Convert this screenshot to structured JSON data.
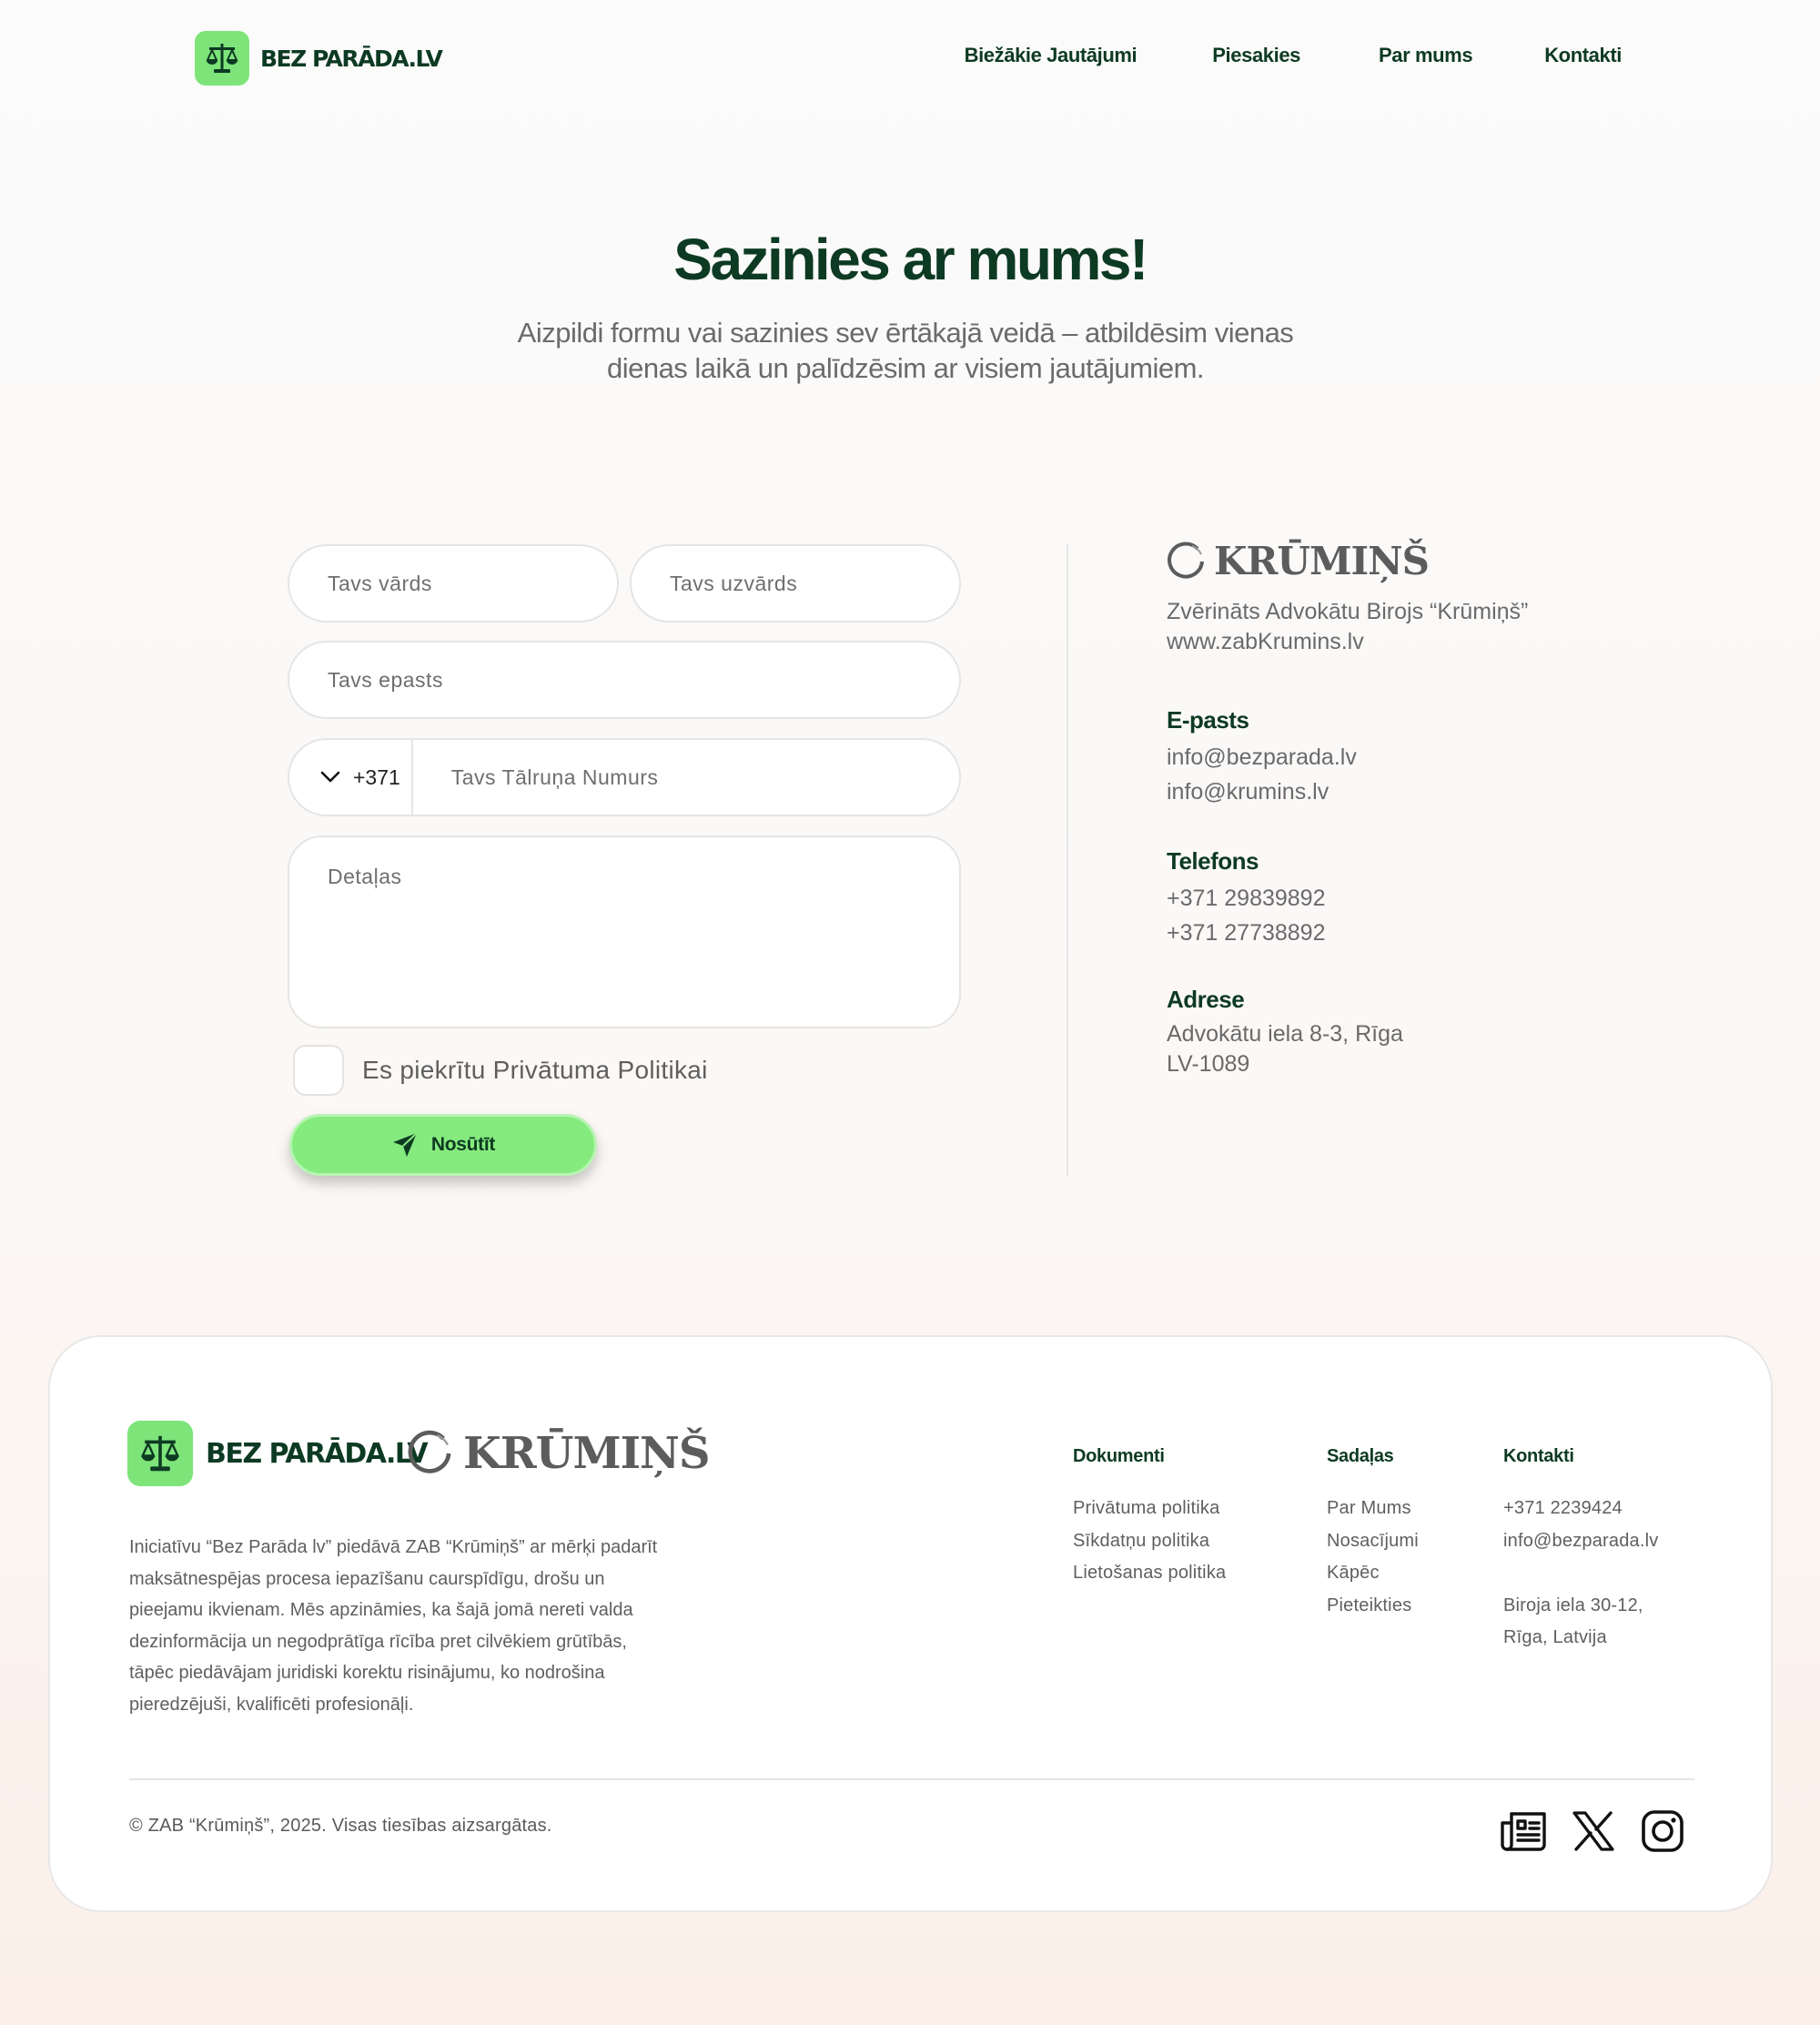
{
  "header": {
    "logo_text": "BEZ PARĀDA.LV",
    "nav": [
      "Biežākie Jautājumi",
      "Piesakies",
      "Par mums",
      "Kontakti"
    ]
  },
  "hero": {
    "title": "Sazinies ar mums!",
    "subtitle_line1": "Aizpildi formu vai sazinies sev ērtākajā veidā – atbildēsim vienas",
    "subtitle_line2": "dienas laikā un palīdzēsim ar visiem jautājumiem."
  },
  "form": {
    "name_placeholder": "Tavs vārds",
    "surname_placeholder": "Tavs uzvārds",
    "email_placeholder": "Tavs epasts",
    "country_code": "+371",
    "phone_placeholder": "Tavs Tālruņa Numurs",
    "details_placeholder": "Detaļas",
    "consent_label": "Es piekrītu Privātuma Politikai",
    "submit_label": "Nosūtīt"
  },
  "contact": {
    "brand": "KRŪMIŅŠ",
    "firm_name": "Zvērināts Advokātu Birojs “Krūmiņš”",
    "website": "www.zabKrumins.lv",
    "email_heading": "E-pasts",
    "emails": [
      "info@bezparada.lv",
      "info@krumins.lv"
    ],
    "phone_heading": "Telefons",
    "phones": [
      "+371 29839892",
      "+371 27738892"
    ],
    "address_heading": "Adrese",
    "address_line1": "Advokātu iela 8-3, Rīga",
    "address_line2": "LV-1089"
  },
  "footer": {
    "logo_text": "BEZ PARĀDA.LV",
    "brand": "KRŪMIŅŠ",
    "description_lines": [
      "Iniciatīvu “Bez Parāda lv” piedāvā ZAB “Krūmiņš” ar mērķi padarīt",
      "maksātnespējas procesa iepazīšanu  caurspīdīgu, drošu un",
      "pieejamu ikvienam. Mēs apzināmies, ka šajā jomā nereti valda",
      "dezinformācija un negodprātīga rīcība pret cilvēkiem grūtībās,",
      "tāpēc piedāvājam juridiski korektu risinājumu, ko nodrošina",
      "pieredzējuši, kvalificēti profesionāļi."
    ],
    "columns": {
      "documents": {
        "title": "Dokumenti",
        "items": [
          "Privātuma politika",
          "Sīkdatņu politika",
          "Lietošanas politika"
        ]
      },
      "sections": {
        "title": "Sadaļas",
        "items": [
          "Par Mums",
          "Nosacījumi",
          "Kāpēc",
          "Pieteikties"
        ]
      },
      "contacts": {
        "title": "Kontakti",
        "phone": "+371 2239424",
        "email": "info@bezparada.lv",
        "address_line1": "Biroja iela 30-12,",
        "address_line2": "Rīga, Latvija"
      }
    },
    "copyright": "© ZAB “Krūmiņš”, 2025. Visas tiesības aizsargātas.",
    "socials": [
      "news-icon",
      "x-icon",
      "instagram-icon"
    ]
  },
  "colors": {
    "brand_green": "#7ee47a",
    "dark_green": "#0d3a22",
    "text_grey": "#6a6a6a"
  }
}
